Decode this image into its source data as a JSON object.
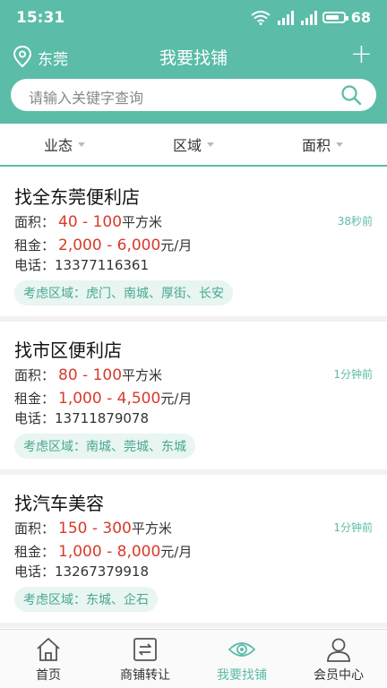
{
  "status": {
    "time": "15:31",
    "battery": "68"
  },
  "header": {
    "city": "东莞",
    "title": "我要找铺",
    "plus": "+"
  },
  "search": {
    "placeholder": "请输入关键字查询"
  },
  "filters": [
    "业态",
    "区域",
    "面积"
  ],
  "listings": [
    {
      "title": "找全东莞便利店",
      "area_label": "面积：",
      "area": "40 - 100",
      "area_unit": "平方米",
      "rent_label": "租金：",
      "rent": "2,000 - 6,000",
      "rent_unit": "元/月",
      "phone_label": "电话：",
      "phone": "13377116361",
      "zones": "考虑区域：虎门、南城、厚街、长安",
      "ago": "38秒前"
    },
    {
      "title": "找市区便利店",
      "area_label": "面积：",
      "area": "80 - 100",
      "area_unit": "平方米",
      "rent_label": "租金：",
      "rent": "1,000 - 4,500",
      "rent_unit": "元/月",
      "phone_label": "电话：",
      "phone": "13711879078",
      "zones": "考虑区域：南城、莞城、东城",
      "ago": "1分钟前"
    },
    {
      "title": "找汽车美容",
      "area_label": "面积：",
      "area": "150 - 300",
      "area_unit": "平方米",
      "rent_label": "租金：",
      "rent": "1,000 - 8,000",
      "rent_unit": "元/月",
      "phone_label": "电话：",
      "phone": "13267379918",
      "zones": "考虑区域：东城、企石",
      "ago": "1分钟前"
    }
  ],
  "tabs": [
    {
      "label": "首页",
      "icon": "home-icon"
    },
    {
      "label": "商铺转让",
      "icon": "transfer-icon"
    },
    {
      "label": "我要找铺",
      "icon": "eye-icon"
    },
    {
      "label": "会员中心",
      "icon": "user-icon"
    }
  ],
  "colors": {
    "accent": "#5bbca8",
    "price": "#d83a2a",
    "tag_bg": "#e8f5f1"
  }
}
